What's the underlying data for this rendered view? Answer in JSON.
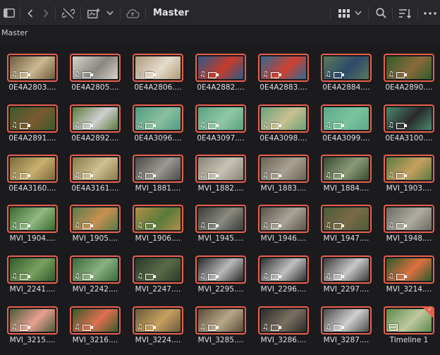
{
  "toolbar": {
    "title": "Master",
    "icons": [
      "sidebar-toggle-icon",
      "chevron-left-icon",
      "chevron-right-icon",
      "unlink-icon",
      "smart-bin-icon",
      "chevron-down-icon",
      "cloud-icon",
      "grid-view-icon",
      "chevron-down-icon",
      "search-icon",
      "sort-icon",
      "more-icon"
    ]
  },
  "path": {
    "label": "Master"
  },
  "clips": [
    {
      "label": "0E4A2803....",
      "c1": "#6b5a3e",
      "c2": "#cdb991"
    },
    {
      "label": "0E4A2805....",
      "c1": "#d8d4cc",
      "c2": "#8a8780"
    },
    {
      "label": "0E4A2806....",
      "c1": "#b09a7a",
      "c2": "#e4dccb"
    },
    {
      "label": "0E4A2882....",
      "c1": "#2a5a8a",
      "c2": "#c73b2a"
    },
    {
      "label": "0E4A2883....",
      "c1": "#2d6b93",
      "c2": "#d04030"
    },
    {
      "label": "0E4A2884....",
      "c1": "#5a7a5a",
      "c2": "#2d4a6a"
    },
    {
      "label": "0E4A2890....",
      "c1": "#2f5b2a",
      "c2": "#8a6a3a"
    },
    {
      "label": "0E4A2891....",
      "c1": "#3c5a2c",
      "c2": "#7a5a30"
    },
    {
      "label": "0E4A2892....",
      "c1": "#5b7a3a",
      "c2": "#cfcfcf"
    },
    {
      "label": "0E4A3096....",
      "c1": "#4f9a80",
      "c2": "#8ac0a0"
    },
    {
      "label": "0E4A3097....",
      "c1": "#5aa080",
      "c2": "#90c8a4"
    },
    {
      "label": "0E4A3098....",
      "c1": "#6aa078",
      "c2": "#c8c090"
    },
    {
      "label": "0E4A3099....",
      "c1": "#5ca888",
      "c2": "#7cc4a0"
    },
    {
      "label": "0E4A3100....",
      "c1": "#4a8a70",
      "c2": "#2a2a2a"
    },
    {
      "label": "0E4A3160....",
      "c1": "#7a6a3a",
      "c2": "#c8b070"
    },
    {
      "label": "0E4A3161....",
      "c1": "#8a7a4a",
      "c2": "#d0c090"
    },
    {
      "label": "MVI_1881....",
      "c1": "#4a4a48",
      "c2": "#9a9890"
    },
    {
      "label": "MVI_1882....",
      "c1": "#8a8478",
      "c2": "#c8c2b4"
    },
    {
      "label": "MVI_1883....",
      "c1": "#6a6458",
      "c2": "#a8a090"
    },
    {
      "label": "MVI_1884....",
      "c1": "#3a4a30",
      "c2": "#8a9a78"
    },
    {
      "label": "MVI_1903....",
      "c1": "#5a7a40",
      "c2": "#c8a060"
    },
    {
      "label": "MVI_1904....",
      "c1": "#3a6a30",
      "c2": "#90b880"
    },
    {
      "label": "MVI_1905....",
      "c1": "#5a7a4a",
      "c2": "#c89050"
    },
    {
      "label": "MVI_1906....",
      "c1": "#b0904a",
      "c2": "#5a7a3a"
    },
    {
      "label": "MVI_1945....",
      "c1": "#3a3a38",
      "c2": "#8a8a80"
    },
    {
      "label": "MVI_1946....",
      "c1": "#5a5248",
      "c2": "#aaa498"
    },
    {
      "label": "MVI_1947....",
      "c1": "#4a5a38",
      "c2": "#7a6a48"
    },
    {
      "label": "MVI_1948....",
      "c1": "#6a6a62",
      "c2": "#b0aca0"
    },
    {
      "label": "MVI_2241....",
      "c1": "#2f5a2a",
      "c2": "#7aa060"
    },
    {
      "label": "MVI_2242....",
      "c1": "#3a6a3a",
      "c2": "#8ab080"
    },
    {
      "label": "MVI_2247....",
      "c1": "#2a3a28",
      "c2": "#5a6a48"
    },
    {
      "label": "MVI_2295....",
      "c1": "#2a2a2a",
      "c2": "#b8b8b8"
    },
    {
      "label": "MVI_2296....",
      "c1": "#2e2e30",
      "c2": "#c0c0c0"
    },
    {
      "label": "MVI_2297....",
      "c1": "#3a3a3a",
      "c2": "#c8c8c8"
    },
    {
      "label": "MVI_3214....",
      "c1": "#2a5a2a",
      "c2": "#e07040"
    },
    {
      "label": "MVI_3215....",
      "c1": "#4a5a3a",
      "c2": "#e8a090"
    },
    {
      "label": "MVI_3216....",
      "c1": "#3a5a2a",
      "c2": "#e07050"
    },
    {
      "label": "MVI_3224....",
      "c1": "#6a5a3a",
      "c2": "#c8a060"
    },
    {
      "label": "MVI_3285....",
      "c1": "#5a4a38",
      "c2": "#b8a888"
    },
    {
      "label": "MVI_3286....",
      "c1": "#2a2a28",
      "c2": "#7a7060"
    },
    {
      "label": "MVI_3287....",
      "c1": "#4a4a48",
      "c2": "#d0d0d0"
    },
    {
      "label": "Timeline 1",
      "c1": "#5a8a4a",
      "c2": "#c0c8a0",
      "timeline": true
    }
  ]
}
